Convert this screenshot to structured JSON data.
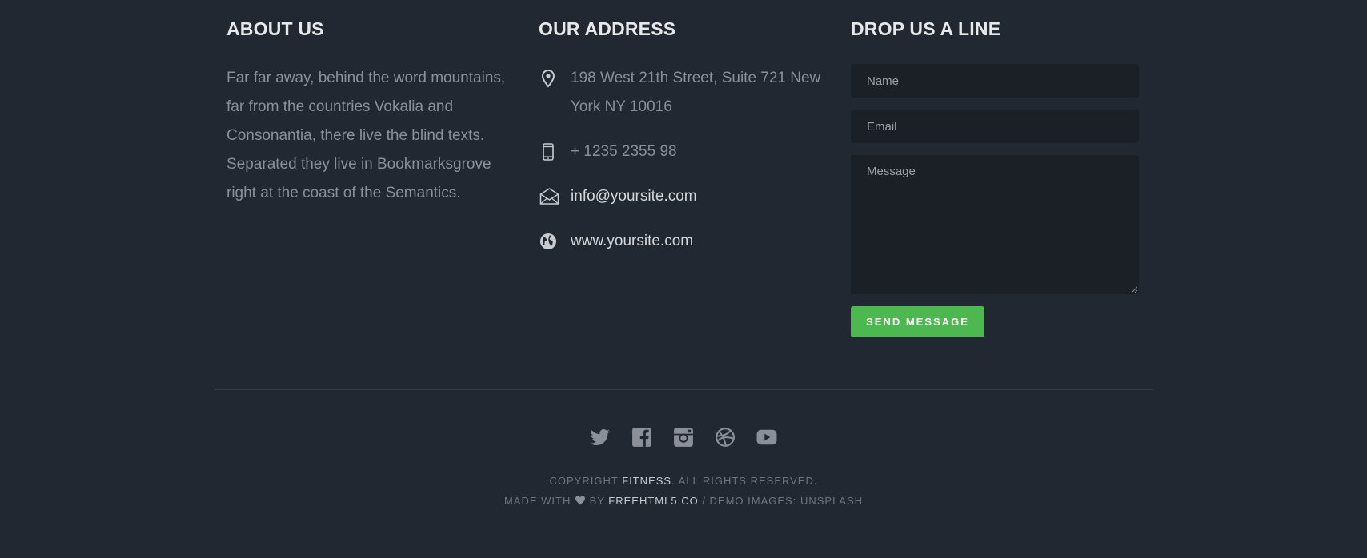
{
  "about": {
    "heading": "ABOUT US",
    "text": "Far far away, behind the word mountains, far from the countries Vokalia and Consonantia, there live the blind texts. Separated they live in Bookmarksgrove right at the coast of the Semantics."
  },
  "address": {
    "heading": "OUR ADDRESS",
    "street": "198 West 21th Street, Suite 721 New York NY 10016",
    "phone": "+ 1235 2355 98",
    "email": "info@yoursite.com",
    "website": "www.yoursite.com"
  },
  "contact": {
    "heading": "DROP US A LINE",
    "name_placeholder": "Name",
    "email_placeholder": "Email",
    "message_placeholder": "Message",
    "send_label": "SEND MESSAGE"
  },
  "social": [
    "twitter-icon",
    "facebook-icon",
    "instagram-icon",
    "dribbble-icon",
    "youtube-icon"
  ],
  "footer": {
    "copyright_prefix": "COPYRIGHT ",
    "brand": "FITNESS",
    "copyright_suffix": ". ALL RIGHTS RESERVED.",
    "made_with": "MADE WITH ",
    "by": " BY ",
    "credit_link": "FREEHTML5.CO",
    "demo_images": " / DEMO IMAGES: ",
    "unsplash": "UNSPLASH"
  },
  "colors": {
    "background": "#222831",
    "accent_green": "#4cb84f",
    "input_bg": "#1b1f26"
  }
}
